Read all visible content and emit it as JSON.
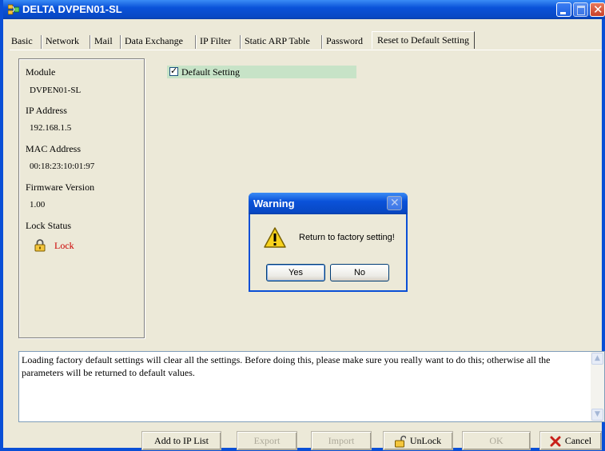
{
  "window": {
    "title": "DELTA DVPEN01-SL"
  },
  "tabs": [
    {
      "label": "Basic"
    },
    {
      "label": "Network"
    },
    {
      "label": "Mail"
    },
    {
      "label": "Data Exchange"
    },
    {
      "label": "IP Filter"
    },
    {
      "label": "Static ARP Table"
    },
    {
      "label": "Password"
    },
    {
      "label": "Reset to Default Setting",
      "active": true
    }
  ],
  "sidebar": {
    "module_label": "Module",
    "module_value": "DVPEN01-SL",
    "ip_label": "IP Address",
    "ip_value": "192.168.1.5",
    "mac_label": "MAC Address",
    "mac_value": "00:18:23:10:01:97",
    "fw_label": "Firmware Version",
    "fw_value": "1.00",
    "lock_label": "Lock Status",
    "lock_value": "Lock",
    "lock_color": "#cc0000"
  },
  "main": {
    "default_setting_label": "Default Setting",
    "default_setting_checked": true
  },
  "dialog": {
    "title": "Warning",
    "message": "Return to factory setting!",
    "yes_label": "Yes",
    "no_label": "No",
    "icon": "warning-icon"
  },
  "description": {
    "text": "Loading factory default settings will clear all the settings. Before doing this, please make sure you really want to do this; otherwise all the parameters will be returned to default values."
  },
  "buttons": {
    "add_to_ip_list": "Add to IP List",
    "export": "Export",
    "import": "Import",
    "unlock": "UnLock",
    "ok": "OK",
    "cancel": "Cancel"
  },
  "colors": {
    "titlebar": "#0a52d9",
    "window_bg": "#ece9d8",
    "highlight_row": "#c7e3c7"
  }
}
